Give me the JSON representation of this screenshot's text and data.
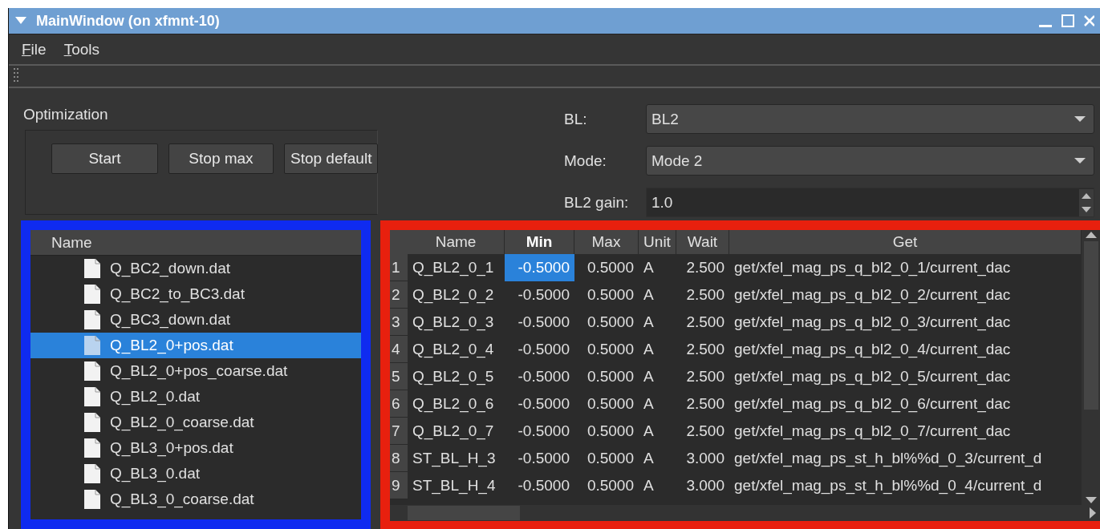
{
  "window": {
    "title": "MainWindow (on xfmnt-10)"
  },
  "menu": [
    {
      "label": "File"
    },
    {
      "label": "Tools"
    }
  ],
  "optimization": {
    "title": "Optimization",
    "buttons": [
      "Start",
      "Stop max",
      "Stop default"
    ]
  },
  "settings": [
    {
      "kind": "combo",
      "label": "BL:",
      "value": "BL2"
    },
    {
      "kind": "combo",
      "label": "Mode:",
      "value": "Mode 2"
    },
    {
      "kind": "spin",
      "label": "BL2 gain:",
      "value": "1.0"
    }
  ],
  "file_tree": {
    "header": "Name",
    "items": [
      {
        "name": "Q_BC2_down.dat",
        "selected": false
      },
      {
        "name": "Q_BC2_to_BC3.dat",
        "selected": false
      },
      {
        "name": "Q_BC3_down.dat",
        "selected": false
      },
      {
        "name": "Q_BL2_0+pos.dat",
        "selected": true
      },
      {
        "name": "Q_BL2_0+pos_coarse.dat",
        "selected": false
      },
      {
        "name": "Q_BL2_0.dat",
        "selected": false
      },
      {
        "name": "Q_BL2_0_coarse.dat",
        "selected": false
      },
      {
        "name": "Q_BL3_0+pos.dat",
        "selected": false
      },
      {
        "name": "Q_BL3_0.dat",
        "selected": false
      },
      {
        "name": "Q_BL3_0_coarse.dat",
        "selected": false
      }
    ]
  },
  "table": {
    "columns": [
      {
        "label": "Name",
        "current": false
      },
      {
        "label": "Min",
        "current": true
      },
      {
        "label": "Max",
        "current": false
      },
      {
        "label": "Unit",
        "current": false
      },
      {
        "label": "Wait",
        "current": false
      },
      {
        "label": "Get",
        "current": false
      }
    ],
    "rows": [
      {
        "header": "1",
        "cells": [
          {
            "text": "Q_BL2_0_1",
            "selected": false
          },
          {
            "text": "-0.5000",
            "selected": true
          },
          {
            "text": "0.5000",
            "selected": false
          },
          {
            "text": "A",
            "selected": false
          },
          {
            "text": "2.500",
            "selected": false
          },
          {
            "text": "get/xfel_mag_ps_q_bl2_0_1/current_dac",
            "selected": false
          }
        ]
      },
      {
        "header": "2",
        "cells": [
          {
            "text": "Q_BL2_0_2",
            "selected": false
          },
          {
            "text": "-0.5000",
            "selected": false
          },
          {
            "text": "0.5000",
            "selected": false
          },
          {
            "text": "A",
            "selected": false
          },
          {
            "text": "2.500",
            "selected": false
          },
          {
            "text": "get/xfel_mag_ps_q_bl2_0_2/current_dac",
            "selected": false
          }
        ]
      },
      {
        "header": "3",
        "cells": [
          {
            "text": "Q_BL2_0_3",
            "selected": false
          },
          {
            "text": "-0.5000",
            "selected": false
          },
          {
            "text": "0.5000",
            "selected": false
          },
          {
            "text": "A",
            "selected": false
          },
          {
            "text": "2.500",
            "selected": false
          },
          {
            "text": "get/xfel_mag_ps_q_bl2_0_3/current_dac",
            "selected": false
          }
        ]
      },
      {
        "header": "4",
        "cells": [
          {
            "text": "Q_BL2_0_4",
            "selected": false
          },
          {
            "text": "-0.5000",
            "selected": false
          },
          {
            "text": "0.5000",
            "selected": false
          },
          {
            "text": "A",
            "selected": false
          },
          {
            "text": "2.500",
            "selected": false
          },
          {
            "text": "get/xfel_mag_ps_q_bl2_0_4/current_dac",
            "selected": false
          }
        ]
      },
      {
        "header": "5",
        "cells": [
          {
            "text": "Q_BL2_0_5",
            "selected": false
          },
          {
            "text": "-0.5000",
            "selected": false
          },
          {
            "text": "0.5000",
            "selected": false
          },
          {
            "text": "A",
            "selected": false
          },
          {
            "text": "2.500",
            "selected": false
          },
          {
            "text": "get/xfel_mag_ps_q_bl2_0_5/current_dac",
            "selected": false
          }
        ]
      },
      {
        "header": "6",
        "cells": [
          {
            "text": "Q_BL2_0_6",
            "selected": false
          },
          {
            "text": "-0.5000",
            "selected": false
          },
          {
            "text": "0.5000",
            "selected": false
          },
          {
            "text": "A",
            "selected": false
          },
          {
            "text": "2.500",
            "selected": false
          },
          {
            "text": "get/xfel_mag_ps_q_bl2_0_6/current_dac",
            "selected": false
          }
        ]
      },
      {
        "header": "7",
        "cells": [
          {
            "text": "Q_BL2_0_7",
            "selected": false
          },
          {
            "text": "-0.5000",
            "selected": false
          },
          {
            "text": "0.5000",
            "selected": false
          },
          {
            "text": "A",
            "selected": false
          },
          {
            "text": "2.500",
            "selected": false
          },
          {
            "text": "get/xfel_mag_ps_q_bl2_0_7/current_dac",
            "selected": false
          }
        ]
      },
      {
        "header": "8",
        "cells": [
          {
            "text": "ST_BL_H_3",
            "selected": false
          },
          {
            "text": "-0.5000",
            "selected": false
          },
          {
            "text": "0.5000",
            "selected": false
          },
          {
            "text": "A",
            "selected": false
          },
          {
            "text": "3.000",
            "selected": false
          },
          {
            "text": "get/xfel_mag_ps_st_h_bl%%d_0_3/current_d",
            "selected": false
          }
        ]
      },
      {
        "header": "9",
        "cells": [
          {
            "text": "ST_BL_H_4",
            "selected": false
          },
          {
            "text": "-0.5000",
            "selected": false
          },
          {
            "text": "0.5000",
            "selected": false
          },
          {
            "text": "A",
            "selected": false
          },
          {
            "text": "3.000",
            "selected": false
          },
          {
            "text": "get/xfel_mag_ps_st_h_bl%%d_0_4/current_d",
            "selected": false
          }
        ]
      }
    ]
  }
}
